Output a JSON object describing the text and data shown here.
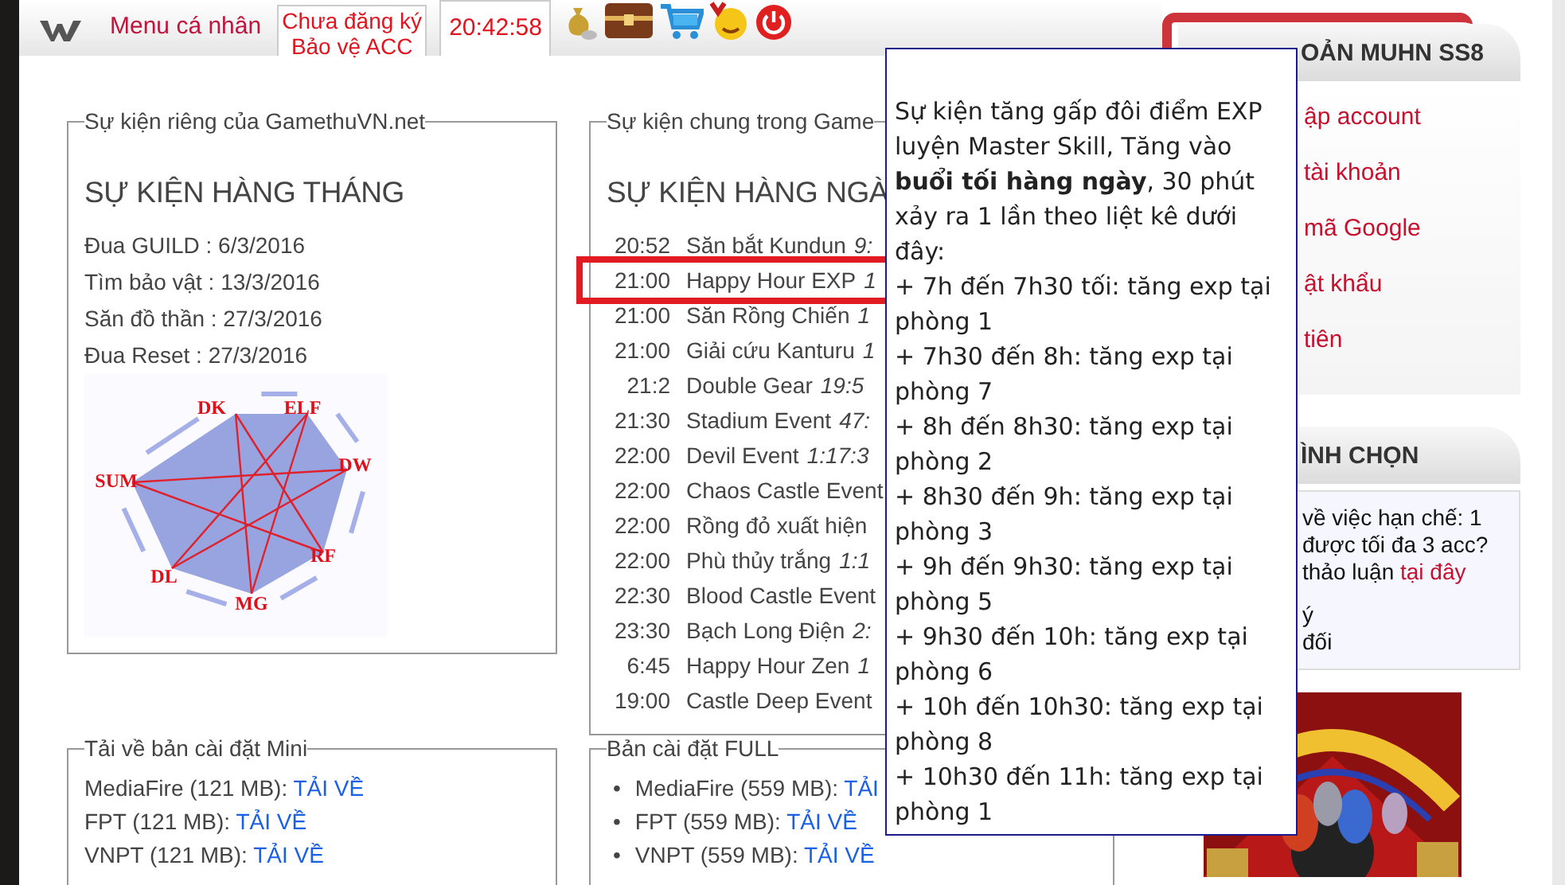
{
  "top_bar": {
    "menu_link": "Menu cá nhân",
    "register_notice": [
      "Chưa đăng ký",
      "Bảo vệ ACC"
    ],
    "clock": "20:42:58"
  },
  "monthly": {
    "legend": "Sự kiện riêng của GamethuVN.net",
    "heading": "SỰ KIỆN HÀNG THÁNG",
    "events": [
      "Đua GUILD : 6/3/2016",
      "Tìm bảo vật : 13/3/2016",
      "Săn đồ thần : 27/3/2016",
      "Đua Reset : 27/3/2016"
    ],
    "cycle": [
      "DK",
      "ELF",
      "DW",
      "RF",
      "MG",
      "DL",
      "SUM"
    ]
  },
  "daily": {
    "legend": "Sự kiện chung trong Game",
    "heading": "SỰ KIỆN HÀNG NGÀ",
    "events": [
      {
        "time": "20:52",
        "name": "Săn bắt Kundun",
        "countdown": "9:",
        "highlighted": false
      },
      {
        "time": "21:00",
        "name": "Happy Hour EXP",
        "countdown": "1",
        "highlighted": true
      },
      {
        "time": "21:00",
        "name": "Săn Rồng Chiến",
        "countdown": "1",
        "highlighted": false
      },
      {
        "time": "21:00",
        "name": "Giải cứu Kanturu",
        "countdown": "1",
        "highlighted": false
      },
      {
        "time": "21:2",
        "name": "Double Gear",
        "countdown": "19:5",
        "highlighted": false
      },
      {
        "time": "21:30",
        "name": "Stadium Event",
        "countdown": "47:",
        "highlighted": false
      },
      {
        "time": "22:00",
        "name": "Devil Event",
        "countdown": "1:17:3",
        "highlighted": false
      },
      {
        "time": "22:00",
        "name": "Chaos Castle Event",
        "highlighted": false
      },
      {
        "time": "22:00",
        "name": "Rồng đỏ xuất hiện",
        "highlighted": false
      },
      {
        "time": "22:00",
        "name": "Phù thủy trắng",
        "countdown": "1:1",
        "highlighted": false
      },
      {
        "time": "22:30",
        "name": "Blood Castle Event",
        "highlighted": false
      },
      {
        "time": "23:30",
        "name": "Bạch Long Điện",
        "countdown": "2:",
        "highlighted": false
      },
      {
        "time": "6:45",
        "name": "Happy Hour Zen",
        "countdown": "1",
        "highlighted": false
      },
      {
        "time": "19:00",
        "name": "Castle Deep Event",
        "highlighted": false
      }
    ]
  },
  "downloads_mini": {
    "legend": "Tải về bản cài đặt Mini",
    "items": [
      {
        "label": "MediaFire (121 MB):",
        "link": "TẢI VỀ"
      },
      {
        "label": "FPT (121 MB):",
        "link": "TẢI VỀ"
      },
      {
        "label": "VNPT (121 MB):",
        "link": "TẢI VỀ"
      }
    ]
  },
  "downloads_full": {
    "legend": "Bản cài đặt FULL",
    "bullet": "•",
    "items": [
      {
        "label": "MediaFire (559 MB):",
        "link": "TẢI"
      },
      {
        "label": "FPT (559 MB):",
        "link": "TẢI VỀ"
      },
      {
        "label": "VNPT (559 MB):",
        "link": "TẢI VỀ"
      }
    ]
  },
  "account_panel": {
    "title": "OẢN MUHN SS8",
    "links": [
      "ập account",
      "tài khoản",
      "mã Google",
      "ật khẩu",
      "tiên"
    ]
  },
  "poll": {
    "title": "ÌNH CHỌN",
    "question_lines": [
      "về việc hạn chế: 1",
      "được tối đa 3 acc?",
      "thảo luận"
    ],
    "link": "tại đây",
    "options": [
      "ý",
      "đối"
    ]
  },
  "tooltip": {
    "intro": "Sự kiện tăng gấp đôi điểm EXP luyện Master Skill, Tăng vào **buổi tối hàng ngày**, 30 phút xảy ra 1 lần theo liệt kê dưới đây:",
    "lines": [
      "+ 7h đến 7h30 tối: tăng exp tại phòng 1",
      "+ 7h30 đến 8h: tăng exp tại phòng 7",
      "+ 8h đến 8h30: tăng exp tại phòng 2",
      "+ 8h30 đến 9h: tăng exp tại phòng 3",
      "+ 9h đến 9h30: tăng exp tại phòng 5",
      "+ 9h30 đến 10h: tăng exp tại phòng 6",
      "+ 10h đến 10h30: tăng exp tại phòng 8",
      "+ 10h30 đến 11h: tăng exp tại phòng 1"
    ]
  }
}
